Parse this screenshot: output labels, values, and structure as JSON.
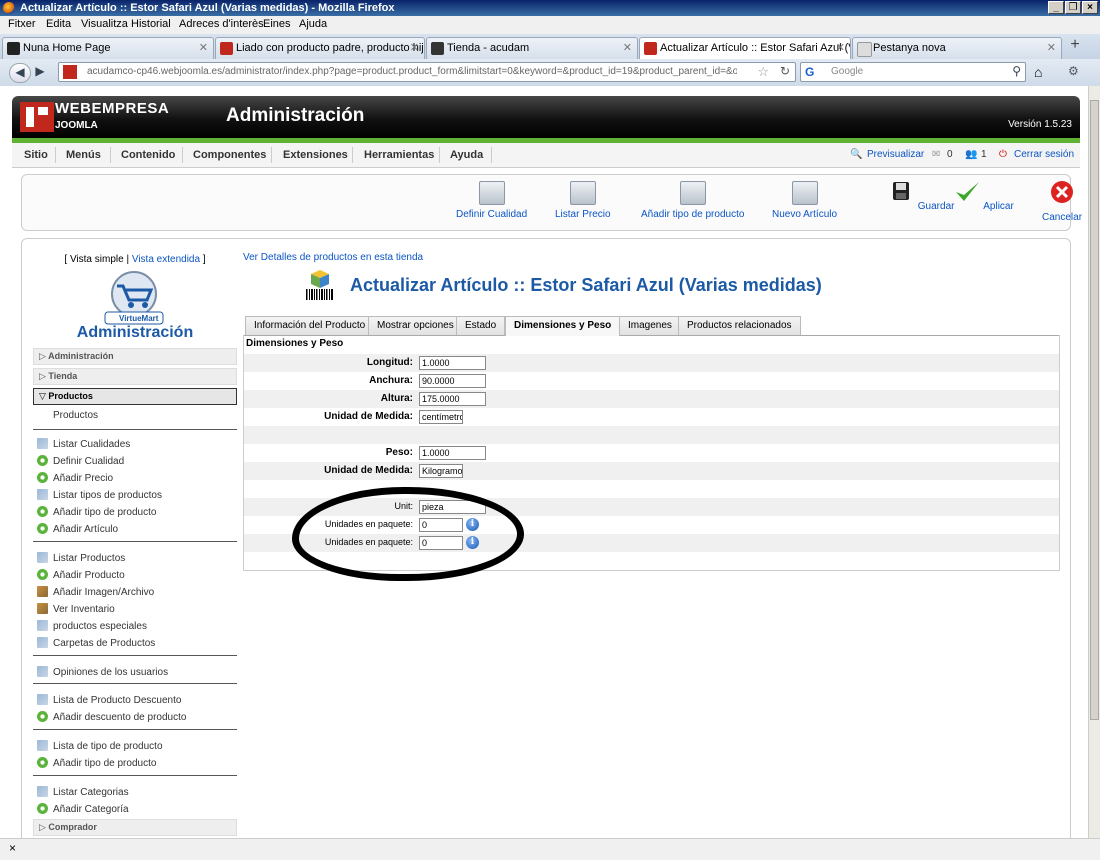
{
  "window": {
    "title": "Actualizar Artículo :: Estor Safari Azul (Varias medidas) - Mozilla Firefox",
    "controls": [
      "_",
      "❐",
      "×"
    ]
  },
  "menubar": [
    "Fitxer",
    "Edita",
    "Visualitza",
    "Historial",
    "Adreces d'interès",
    "Eines",
    "Ajuda"
  ],
  "tabs": [
    {
      "label": "Nuna Home Page",
      "color": "#222222"
    },
    {
      "label": "Liado con producto padre, producto hijo...",
      "color": "#c0281d"
    },
    {
      "label": "Tienda - acudam",
      "color": "#333333"
    },
    {
      "label": "Actualizar Artículo :: Estor Safari Azul (V...",
      "color": "#c0281d"
    },
    {
      "label": "Pestanya nova",
      "color": "#dddddd"
    }
  ],
  "nav": {
    "url": "acudamco-cp46.webjoomla.es/administrator/index.php?page=product.product_form&limitstart=0&keyword=&product_id=19&product_parent_id=&option=cc",
    "search_placeholder": "Google"
  },
  "header": {
    "brand_top": "WEBEMPRESA",
    "brand_bottom": "JOOMLA",
    "title": "Administración",
    "version": "Versión 1.5.23"
  },
  "admin_menu": {
    "items": [
      "Sitio",
      "Menús",
      "Contenido",
      "Componentes",
      "Extensiones",
      "Herramientas",
      "Ayuda"
    ],
    "preview": "Previsualizar",
    "messages": "0",
    "users": "1",
    "logout": "Cerrar sesión"
  },
  "toolbar": {
    "definir_cualidad": "Definir Cualidad",
    "listar_precio": "Listar Precio",
    "anadir_tipo": "Añadir tipo de producto",
    "nuevo_articulo": "Nuevo Artículo",
    "guardar": "Guardar",
    "aplicar": "Aplicar",
    "cancelar": "Cancelar"
  },
  "sidebar": {
    "vista_simple": "[ Vista simple |",
    "vista_extendida": "Vista extendida",
    "vista_close": "]",
    "logo_text": "VirtueMart",
    "title": "Administración",
    "sections": [
      "Administración",
      "Tienda",
      "Productos"
    ],
    "productos_sub": "Productos",
    "items": [
      "Listar Cualidades",
      "Definir Cualidad",
      "Añadir Precio",
      "Listar tipos de productos",
      "Añadir tipo de producto",
      "Añadir Artículo",
      "Listar Productos",
      "Añadir Producto",
      "Añadir Imagen/Archivo",
      "Ver Inventario",
      "productos especiales",
      "Carpetas de Productos",
      "Opiniones de los usuarios",
      "Lista de Producto Descuento",
      "Añadir descuento de producto",
      "Lista de tipo de producto",
      "Añadir tipo de producto",
      "Listar Categorias",
      "Añadir Categoría"
    ],
    "section_comprador": "Comprador"
  },
  "main": {
    "top_link": "Ver Detalles de productos en esta tienda",
    "heading": "Actualizar Artículo :: Estor Safari Azul (Varias medidas)",
    "tabs": [
      "Información del Producto",
      "Mostrar opciones",
      "Estado",
      "Dimensiones y Peso",
      "Imagenes",
      "Productos relacionados"
    ],
    "panel_title": "Dimensiones y Peso",
    "fields": {
      "longitud_label": "Longitud:",
      "longitud": "1.0000",
      "anchura_label": "Anchura:",
      "anchura": "90.0000",
      "altura_label": "Altura:",
      "altura": "175.0000",
      "unidad1_label": "Unidad de Medida:",
      "unidad1": "centímetro",
      "peso_label": "Peso:",
      "peso": "1.0000",
      "unidad2_label": "Unidad de Medida:",
      "unidad2": "Kilogramo",
      "unit_label": "Unit:",
      "unit": "pieza",
      "paquete1_label": "Unidades en paquete:",
      "paquete1": "0",
      "paquete2_label": "Unidades en paquete:",
      "paquete2": "0",
      "info_glyph": "i"
    }
  },
  "status": {
    "close": "×"
  }
}
